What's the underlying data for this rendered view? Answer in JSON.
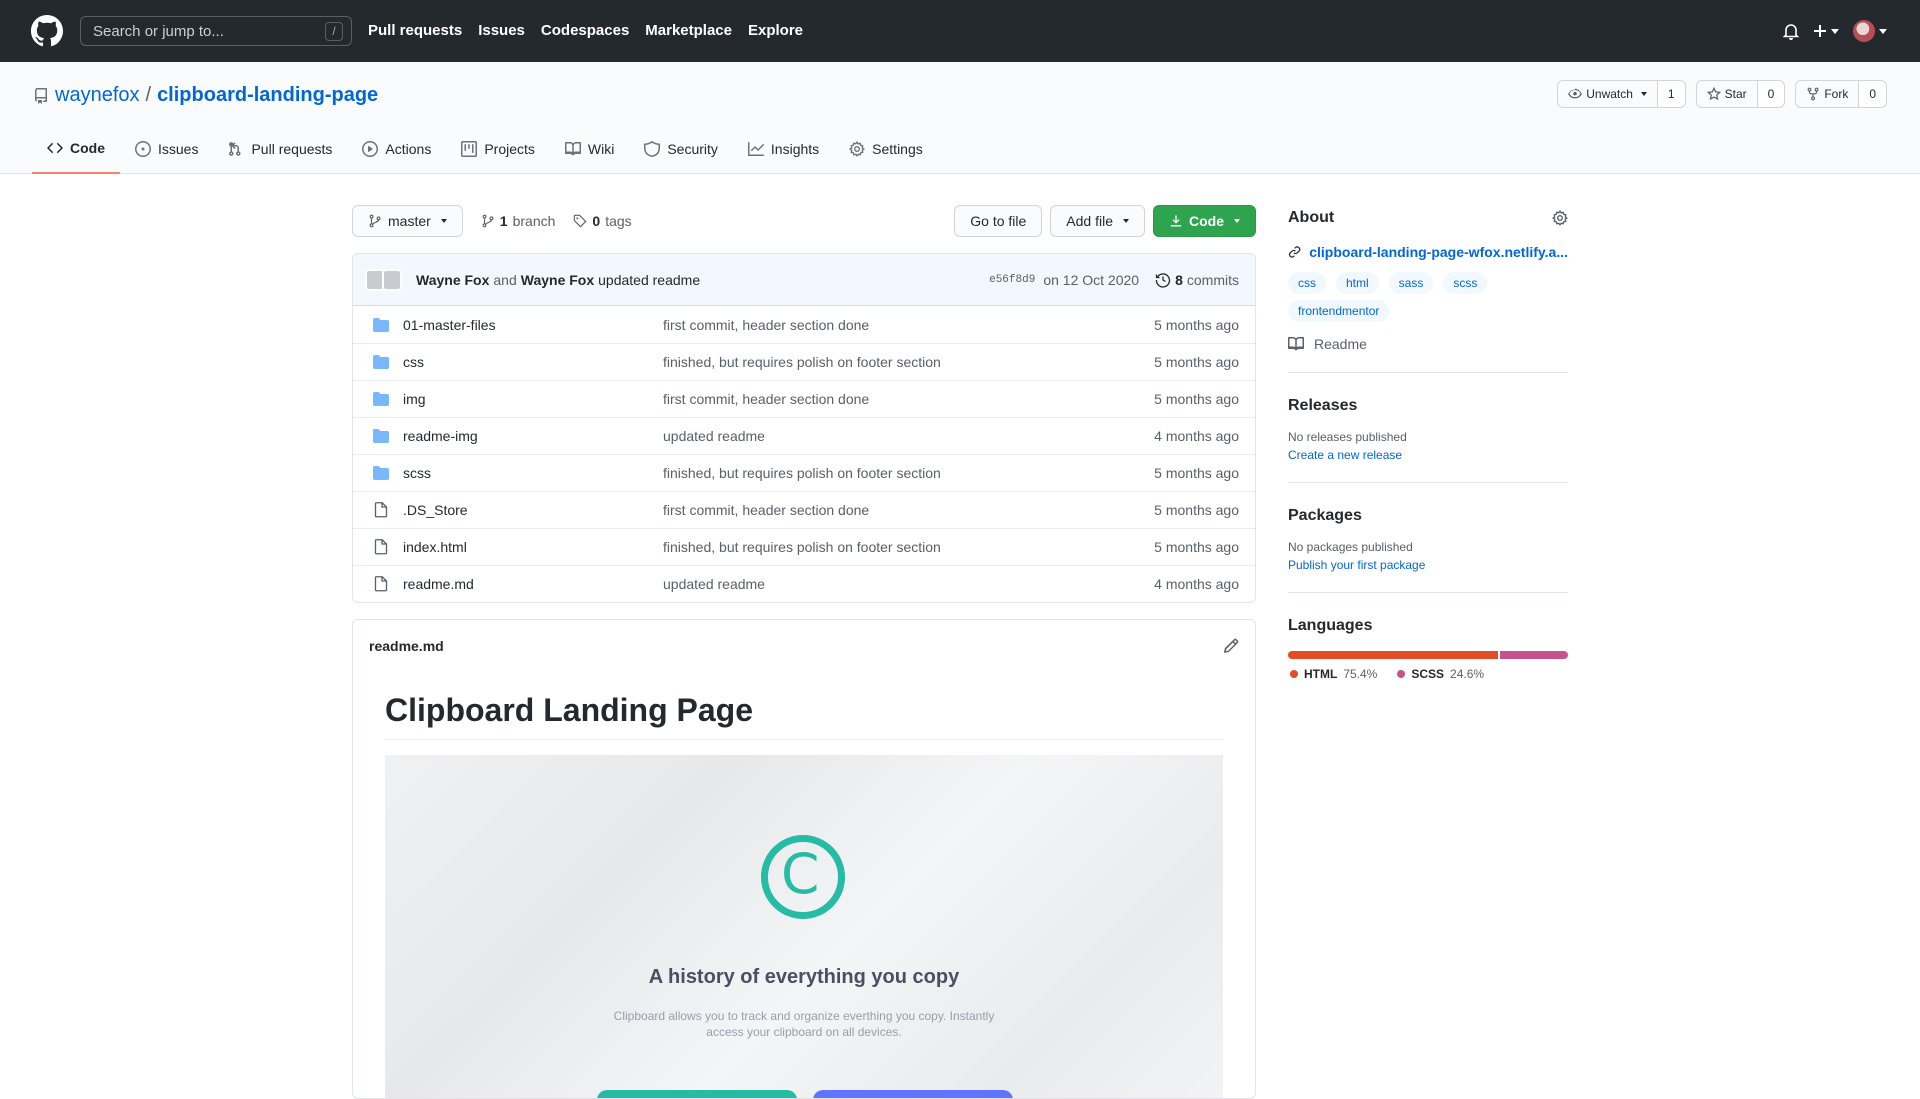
{
  "header": {
    "search_placeholder": "Search or jump to...",
    "search_shortcut": "/",
    "nav": [
      "Pull requests",
      "Issues",
      "Codespaces",
      "Marketplace",
      "Explore"
    ]
  },
  "repo": {
    "owner": "waynefox",
    "separator": "/",
    "name": "clipboard-landing-page",
    "watch_label": "Unwatch",
    "watch_count": "1",
    "star_label": "Star",
    "star_count": "0",
    "fork_label": "Fork",
    "fork_count": "0"
  },
  "tabs": [
    {
      "label": "Code",
      "icon": "code-icon",
      "active": true
    },
    {
      "label": "Issues",
      "icon": "issue-icon"
    },
    {
      "label": "Pull requests",
      "icon": "pull-request-icon"
    },
    {
      "label": "Actions",
      "icon": "play-icon"
    },
    {
      "label": "Projects",
      "icon": "project-icon"
    },
    {
      "label": "Wiki",
      "icon": "book-icon"
    },
    {
      "label": "Security",
      "icon": "shield-icon"
    },
    {
      "label": "Insights",
      "icon": "graph-icon"
    },
    {
      "label": "Settings",
      "icon": "gear-icon"
    }
  ],
  "toolbar": {
    "branch": "master",
    "branch_count": "1",
    "branch_label": "branch",
    "tag_count": "0",
    "tag_label": "tags",
    "go_to_file": "Go to file",
    "add_file": "Add file",
    "code": "Code"
  },
  "commit": {
    "author1": "Wayne Fox",
    "and": "and",
    "author2": "Wayne Fox",
    "message": "updated readme",
    "sha": "e56f8d9",
    "date": "on 12 Oct 2020",
    "count": "8",
    "count_label": "commits"
  },
  "files": [
    {
      "type": "dir",
      "name": "01-master-files",
      "message": "first commit, header section done",
      "age": "5 months ago"
    },
    {
      "type": "dir",
      "name": "css",
      "message": "finished, but requires polish on footer section",
      "age": "5 months ago"
    },
    {
      "type": "dir",
      "name": "img",
      "message": "first commit, header section done",
      "age": "5 months ago"
    },
    {
      "type": "dir",
      "name": "readme-img",
      "message": "updated readme",
      "age": "4 months ago"
    },
    {
      "type": "dir",
      "name": "scss",
      "message": "finished, but requires polish on footer section",
      "age": "5 months ago"
    },
    {
      "type": "file",
      "name": ".DS_Store",
      "message": "first commit, header section done",
      "age": "5 months ago"
    },
    {
      "type": "file",
      "name": "index.html",
      "message": "finished, but requires polish on footer section",
      "age": "5 months ago"
    },
    {
      "type": "file",
      "name": "readme.md",
      "message": "updated readme",
      "age": "4 months ago"
    }
  ],
  "readme": {
    "filename": "readme.md",
    "title": "Clipboard Landing Page",
    "hero_title": "A history of everything you copy",
    "hero_sub": "Clipboard allows you to track and organize everthing you copy. Instantly access your clipboard on all devices."
  },
  "about": {
    "title": "About",
    "homepage": "clipboard-landing-page-wfox.netlify.a...",
    "topics": [
      "css",
      "html",
      "sass",
      "scss",
      "frontendmentor"
    ],
    "readme_label": "Readme"
  },
  "releases": {
    "title": "Releases",
    "empty": "No releases published",
    "link": "Create a new release"
  },
  "packages": {
    "title": "Packages",
    "empty": "No packages published",
    "link": "Publish your first package"
  },
  "languages": {
    "title": "Languages",
    "items": [
      {
        "name": "HTML",
        "percent": "75.4%",
        "value": 75.4,
        "color": "#e34c26"
      },
      {
        "name": "SCSS",
        "percent": "24.6%",
        "value": 24.6,
        "color": "#c6538c"
      }
    ]
  }
}
